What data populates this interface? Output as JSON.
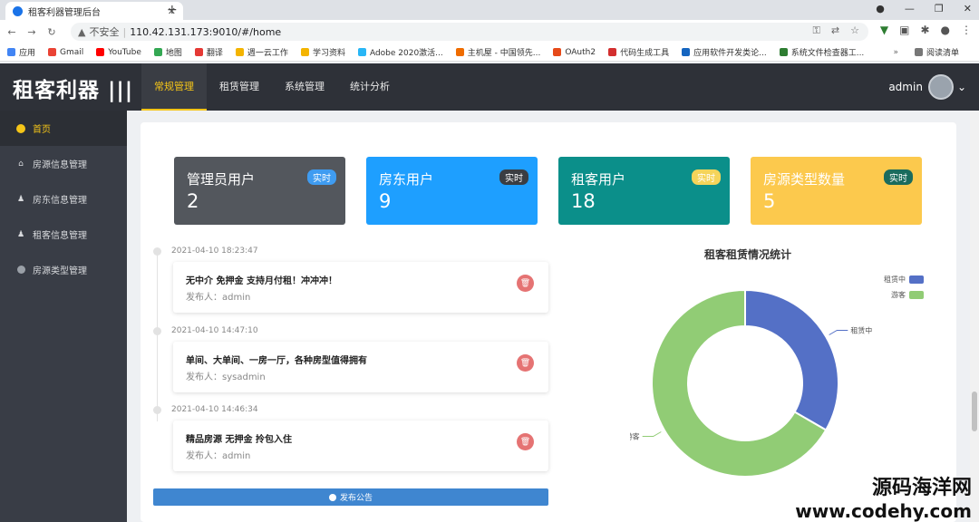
{
  "browser": {
    "tab_title": "租客利器管理后台",
    "url_warning": "不安全",
    "url": "110.42.131.173:9010/#/home",
    "bookmarks": [
      {
        "label": "应用",
        "color": "#4285f4"
      },
      {
        "label": "Gmail",
        "color": "#ea4335"
      },
      {
        "label": "YouTube",
        "color": "#ff0000"
      },
      {
        "label": "地图",
        "color": "#34a853"
      },
      {
        "label": "翻译",
        "color": "#e53935"
      },
      {
        "label": "週一云工作",
        "color": "#f4b400"
      },
      {
        "label": "学习资料",
        "color": "#f4b400"
      },
      {
        "label": "Adobe 2020激活...",
        "color": "#29b6f6"
      },
      {
        "label": "主机屋 - 中国领先...",
        "color": "#ef6c00"
      },
      {
        "label": "OAuth2",
        "color": "#e64a19"
      },
      {
        "label": "代码生成工具",
        "color": "#d32f2f"
      },
      {
        "label": "应用软件开发类论...",
        "color": "#1565c0"
      },
      {
        "label": "系统文件检查器工...",
        "color": "#2e7d32"
      }
    ],
    "reading_list": "阅读清单"
  },
  "app": {
    "logo": "租客利器 |||",
    "nav": [
      "常规管理",
      "租赁管理",
      "系统管理",
      "统计分析"
    ],
    "active_nav": 0,
    "user": "admin",
    "sidebar": [
      {
        "label": "首页",
        "active": true
      },
      {
        "label": "房源信息管理",
        "active": false
      },
      {
        "label": "房东信息管理",
        "active": false
      },
      {
        "label": "租客信息管理",
        "active": false
      },
      {
        "label": "房源类型管理",
        "active": false
      }
    ],
    "cards": [
      {
        "title": "管理员用户",
        "value": "2",
        "badge": "实时",
        "bg": "#53575d",
        "badge_bg": "#3f9cf1",
        "badge_color": "#ffffff"
      },
      {
        "title": "房东用户",
        "value": "9",
        "badge": "实时",
        "bg": "#1e9fff",
        "badge_bg": "#3a3d42",
        "badge_color": "#ffffff"
      },
      {
        "title": "租客用户",
        "value": "18",
        "badge": "实时",
        "bg": "#0b8f8a",
        "badge_bg": "#f5d45a",
        "badge_color": "#ffffff"
      },
      {
        "title": "房源类型数量",
        "value": "5",
        "badge": "实时",
        "bg": "#fcc94d",
        "badge_bg": "#1a6b5d",
        "badge_color": "#ffffff"
      }
    ],
    "timeline": [
      {
        "time": "2021-04-10 18:23:47",
        "text": "无中介 免押金 支持月付租！冲冲冲！",
        "author": "发布人：admin"
      },
      {
        "time": "2021-04-10 14:47:10",
        "text": "单间、大单间、一房一厅，各种房型值得拥有",
        "author": "发布人：sysadmin"
      },
      {
        "time": "2021-04-10 14:46:34",
        "text": "精品房源 无押金 拎包入住",
        "author": "发布人：admin"
      }
    ],
    "publish_label": "发布公告"
  },
  "chart_data": {
    "type": "pie",
    "title": "租客租赁情况统计",
    "series": [
      {
        "name": "租赁中",
        "value": 6,
        "color": "#5470c6"
      },
      {
        "name": "游客",
        "value": 12,
        "color": "#91cc75"
      }
    ],
    "donut": true,
    "legend": "top-right"
  },
  "watermark": {
    "line1": "源码海洋网",
    "line2": "www.codehy.com"
  }
}
